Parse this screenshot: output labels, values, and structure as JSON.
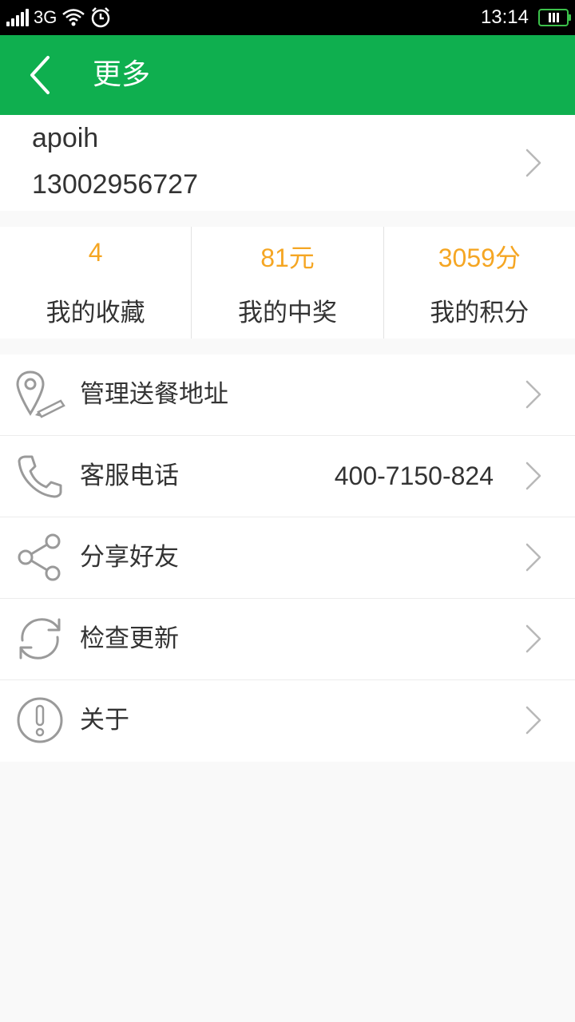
{
  "status_bar": {
    "network": "3G",
    "time": "13:14"
  },
  "header": {
    "title": "更多"
  },
  "profile": {
    "username": "apoih",
    "phone": "13002956727"
  },
  "stats": [
    {
      "value": "4",
      "label": "我的收藏"
    },
    {
      "value": "81元",
      "label": "我的中奖"
    },
    {
      "value": "3059分",
      "label": "我的积分"
    }
  ],
  "menu": [
    {
      "label": "管理送餐地址",
      "icon": "location-pin-icon"
    },
    {
      "label": "客服电话",
      "value": "400-7150-824",
      "icon": "phone-icon"
    },
    {
      "label": "分享好友",
      "icon": "share-icon"
    },
    {
      "label": "检查更新",
      "icon": "refresh-icon"
    },
    {
      "label": "关于",
      "icon": "info-icon"
    }
  ],
  "colors": {
    "header_green": "#0faf4f",
    "stat_orange": "#f5a623",
    "battery_green": "#3cc14b"
  }
}
